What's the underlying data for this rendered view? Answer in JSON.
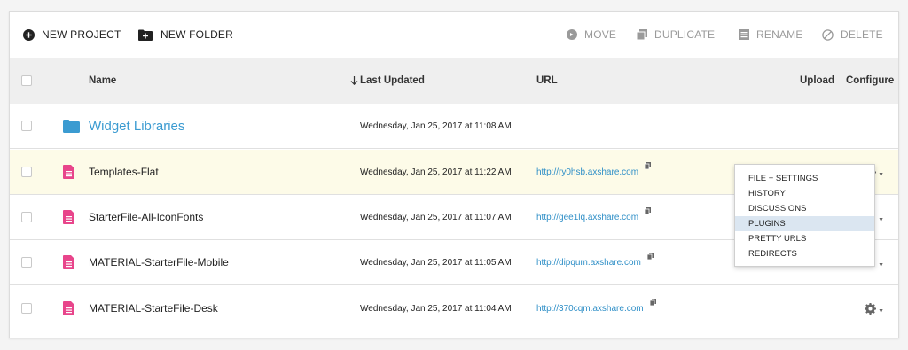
{
  "toolbar": {
    "new_project": "NEW PROJECT",
    "new_folder": "NEW FOLDER",
    "move": "MOVE",
    "duplicate": "DUPLICATE",
    "rename": "RENAME",
    "delete": "DELETE"
  },
  "columns": {
    "name": "Name",
    "last_updated": "Last Updated",
    "url": "URL",
    "upload": "Upload",
    "configure": "Configure"
  },
  "rows": [
    {
      "name": "Widget Libraries",
      "type": "folder",
      "date": "Wednesday, Jan 25, 2017 at 11:08 AM",
      "url": ""
    },
    {
      "name": "Templates-Flat",
      "type": "file",
      "date": "Wednesday, Jan 25, 2017 at 11:22 AM",
      "url": "http://ry0hsb.axshare.com"
    },
    {
      "name": "StarterFile-All-IconFonts",
      "type": "file",
      "date": "Wednesday, Jan 25, 2017 at 11:07 AM",
      "url": "http://gee1lq.axshare.com"
    },
    {
      "name": "MATERIAL-StarterFile-Mobile",
      "type": "file",
      "date": "Wednesday, Jan 25, 2017 at 11:05 AM",
      "url": "http://dipqum.axshare.com"
    },
    {
      "name": "MATERIAL-StarteFile-Desk",
      "type": "file",
      "date": "Wednesday, Jan 25, 2017 at 11:04 AM",
      "url": "http://370cqm.axshare.com"
    }
  ],
  "configure_menu": {
    "items": [
      "FILE + SETTINGS",
      "HISTORY",
      "DISCUSSIONS",
      "PLUGINS",
      "PRETTY URLS",
      "REDIRECTS"
    ],
    "active": "PLUGINS"
  },
  "colors": {
    "folder_blue": "#3b9bd1",
    "file_pink": "#e8458b",
    "link_blue": "#2f8fc7",
    "highlight_row": "#fdfbe8",
    "menu_active": "#dbe6f1"
  },
  "icons": {
    "new_project": "plus-circle-icon",
    "new_folder": "folder-plus-icon",
    "move": "arrow-circle-icon",
    "duplicate": "duplicate-icon",
    "rename": "rename-icon",
    "delete": "no-entry-icon",
    "sort": "down-arrow-icon",
    "folder": "folder-icon",
    "file": "document-icon",
    "copy": "copy-icon",
    "configure": "gear-icon"
  }
}
